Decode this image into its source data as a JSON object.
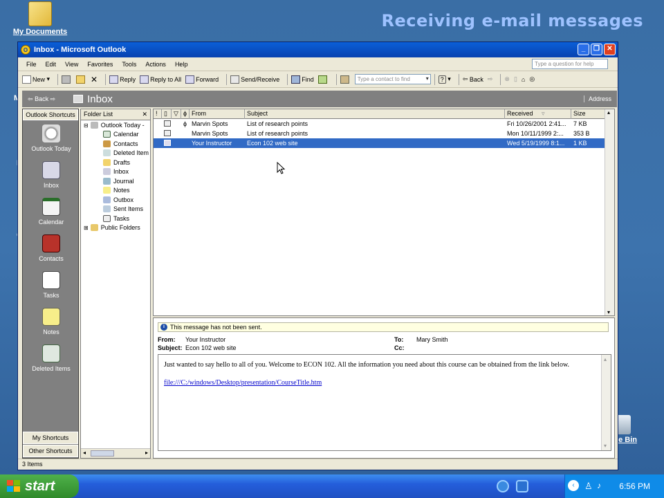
{
  "slide_title": "Receiving e-mail messages",
  "desktop": {
    "my_documents": "My Documents",
    "recycle_bin_fragment": "le Bin",
    "left_fragments": [
      "M",
      "M",
      "C"
    ]
  },
  "window": {
    "title": "Inbox - Microsoft Outlook",
    "menu": [
      "File",
      "Edit",
      "View",
      "Favorites",
      "Tools",
      "Actions",
      "Help"
    ],
    "help_placeholder": "Type a question for help",
    "toolbar": {
      "new": "New",
      "reply": "Reply",
      "reply_all": "Reply to All",
      "forward": "Forward",
      "send_receive": "Send/Receive",
      "find": "Find",
      "contact_placeholder": "Type a contact to find",
      "back": "Back"
    },
    "nav": {
      "back": "Back",
      "folder": "Inbox",
      "address": "Address"
    },
    "shortcuts": {
      "header": "Outlook Shortcuts",
      "items": [
        "Outlook Today",
        "Inbox",
        "Calendar",
        "Contacts",
        "Tasks",
        "Notes",
        "Deleted Items"
      ],
      "my_shortcuts": "My Shortcuts",
      "other_shortcuts": "Other Shortcuts"
    },
    "folder_list": {
      "header": "Folder List",
      "root": "Outlook Today -",
      "children": [
        "Calendar",
        "Contacts",
        "Deleted Item",
        "Drafts",
        "Inbox",
        "Journal",
        "Notes",
        "Outbox",
        "Sent Items",
        "Tasks"
      ],
      "public": "Public Folders"
    },
    "message_list": {
      "columns": {
        "from": "From",
        "subject": "Subject",
        "received": "Received",
        "size": "Size"
      },
      "rows": [
        {
          "from": "Marvin Spots",
          "subject": "List of research points",
          "received": "Fri 10/26/2001 2:41...",
          "size": "7 KB",
          "attachment": true,
          "selected": false
        },
        {
          "from": "Marvin Spots",
          "subject": "List of research points",
          "received": "Mon 10/11/1999 2:...",
          "size": "353 B",
          "attachment": false,
          "selected": false
        },
        {
          "from": "Your Instructor",
          "subject": "Econ 102 web site",
          "received": "Wed 5/19/1999 8:1...",
          "size": "1 KB",
          "attachment": false,
          "selected": true
        }
      ]
    },
    "preview": {
      "info": "This message has not been sent.",
      "from_label": "From:",
      "from": "Your Instructor",
      "subject_label": "Subject:",
      "subject": "Econ 102 web site",
      "to_label": "To:",
      "to": "Mary Smith",
      "cc_label": "Cc:",
      "body": "Just wanted to say hello to all of you. Welcome to ECON 102. All the information you need about this course can be obtained from the link below.",
      "link": "file:///C:/windows/Desktop/presentation/CourseTitle.htm"
    },
    "status": "3 Items"
  },
  "taskbar": {
    "start": "start",
    "time": "6:56 PM"
  }
}
